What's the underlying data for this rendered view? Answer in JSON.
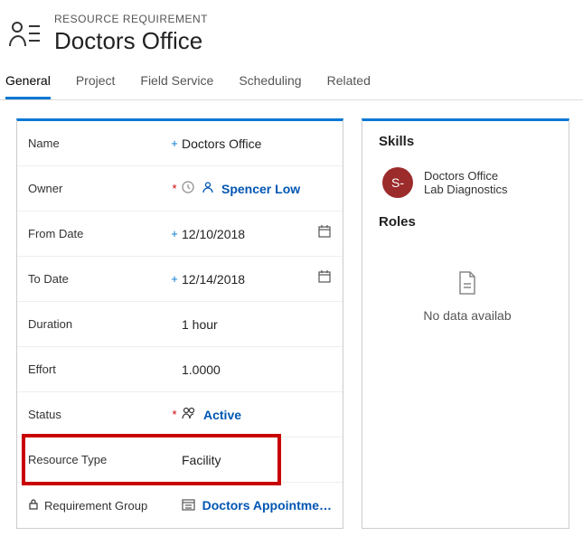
{
  "header": {
    "subtitle": "RESOURCE REQUIREMENT",
    "title": "Doctors Office"
  },
  "tabs": [
    "General",
    "Project",
    "Field Service",
    "Scheduling",
    "Related"
  ],
  "activeTab": "General",
  "fields": {
    "name": {
      "label": "Name",
      "value": "Doctors Office",
      "marker": "+"
    },
    "owner": {
      "label": "Owner",
      "value": "Spencer Low",
      "marker": "*"
    },
    "fromDate": {
      "label": "From Date",
      "value": "12/10/2018",
      "marker": "+"
    },
    "toDate": {
      "label": "To Date",
      "value": "12/14/2018",
      "marker": "+"
    },
    "duration": {
      "label": "Duration",
      "value": "1 hour"
    },
    "effort": {
      "label": "Effort",
      "value": "1.0000"
    },
    "status": {
      "label": "Status",
      "value": "Active",
      "marker": "*"
    },
    "resourceType": {
      "label": "Resource Type",
      "value": "Facility"
    },
    "reqGroup": {
      "label": "Requirement Group",
      "value": "Doctors Appointme…"
    }
  },
  "skills": {
    "heading": "Skills",
    "avatar": "S-",
    "line1": "Doctors Office",
    "line2": "Lab Diagnostics"
  },
  "roles": {
    "heading": "Roles",
    "empty": "No data availab"
  }
}
